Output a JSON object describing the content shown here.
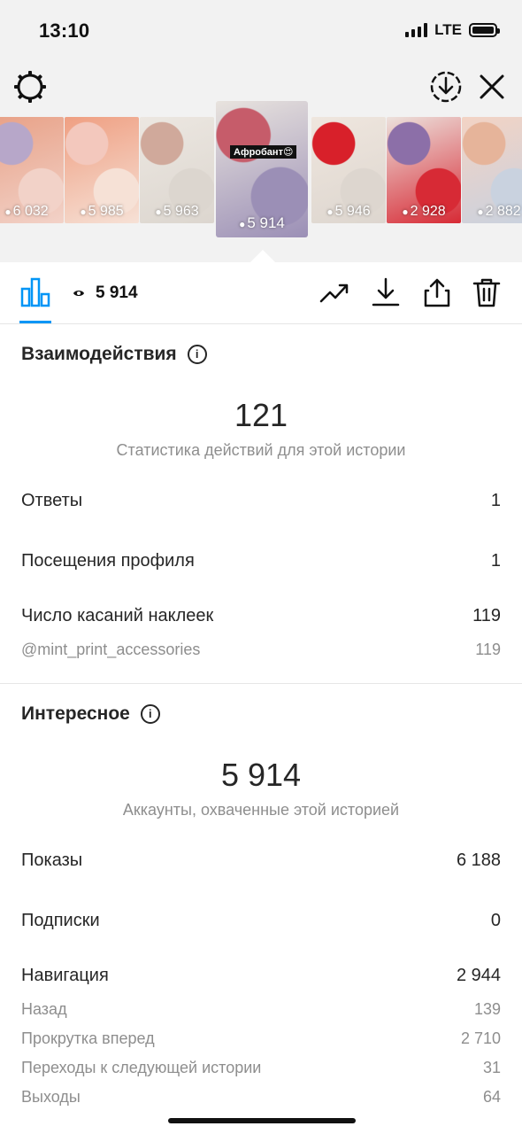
{
  "status": {
    "time": "13:10",
    "network": "LTE"
  },
  "stories": [
    {
      "views": "6 032",
      "colors": [
        "#e8a187",
        "#b7a7c9",
        "#f2d2c8"
      ]
    },
    {
      "views": "5 985",
      "colors": [
        "#ef9f82",
        "#f3c8bd",
        "#f6e1d6"
      ]
    },
    {
      "views": "5 963",
      "colors": [
        "#ece7e1",
        "#d0a99b",
        "#dcd6cf"
      ]
    },
    {
      "views": "5 914",
      "colors": [
        "#e8e3de",
        "#c65c6a",
        "#9b8fb6"
      ],
      "active": true,
      "caption": "Афробант😍"
    },
    {
      "views": "5 946",
      "colors": [
        "#efe6de",
        "#d8202a",
        "#ddd6cf"
      ]
    },
    {
      "views": "2 928",
      "colors": [
        "#ece1dc",
        "#8c6fa8",
        "#d72a35"
      ]
    },
    {
      "views": "2 882",
      "colors": [
        "#f3d3c4",
        "#e6b49a",
        "#c9d2df"
      ]
    }
  ],
  "toolbar": {
    "views": "5 914"
  },
  "interactions": {
    "title": "Взаимодействия",
    "total": "121",
    "subtitle": "Статистика действий для этой истории",
    "rows": [
      {
        "label": "Ответы",
        "value": "1"
      },
      {
        "label": "Посещения профиля",
        "value": "1"
      },
      {
        "label": "Число касаний наклеек",
        "value": "119"
      }
    ],
    "sub_rows": [
      {
        "label": "@mint_print_accessories",
        "value": "119"
      }
    ]
  },
  "discovery": {
    "title": "Интересное",
    "total": "5 914",
    "subtitle": "Аккаунты, охваченные этой историей",
    "rows": [
      {
        "label": "Показы",
        "value": "6 188"
      },
      {
        "label": "Подписки",
        "value": "0"
      },
      {
        "label": "Навигация",
        "value": "2 944"
      }
    ],
    "sub_rows": [
      {
        "label": "Назад",
        "value": "139"
      },
      {
        "label": "Прокрутка вперед",
        "value": "2 710"
      },
      {
        "label": "Переходы к следующей истории",
        "value": "31"
      },
      {
        "label": "Выходы",
        "value": "64"
      }
    ]
  }
}
